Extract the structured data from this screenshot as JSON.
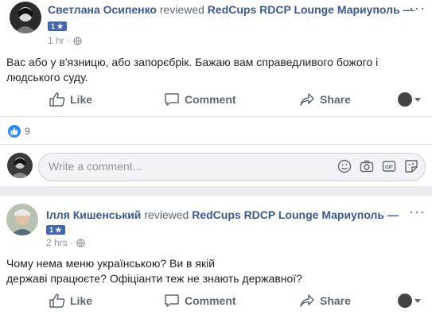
{
  "posts": [
    {
      "author": "Светлана Осипенко",
      "verb": "reviewed",
      "page": "RedCups RDCP Lounge Мариуполь —",
      "rating": "1 ★",
      "time": "1 hr ·",
      "text_lines": [
        "Вас або у в'язницю, або запорєбрік. Бажаю вам справедливого божого і",
        "людського суду."
      ],
      "actions": {
        "like": "Like",
        "comment": "Comment",
        "share": "Share"
      },
      "likes_count": "9",
      "comment_placeholder": "Write a comment..."
    },
    {
      "author": "Ілля Кишенський",
      "verb": "reviewed",
      "page": "RedCups RDCP Lounge Мариуполь —",
      "rating": "1 ★",
      "time": "2 hrs ·",
      "text_lines": [
        "Чому нема меню українською? Ви в якій",
        "державі працюєте? Офіціанти теж не знають державної?"
      ],
      "actions": {
        "like": "Like",
        "comment": "Comment",
        "share": "Share"
      }
    }
  ],
  "more_menu": "···",
  "icons": [
    "more-options-icon",
    "globe-icon",
    "like-icon",
    "comment-icon",
    "share-icon",
    "emoji-icon",
    "camera-icon",
    "gif-icon",
    "sticker-icon",
    "like-reaction-icon"
  ],
  "colors": {
    "link": "#385898",
    "badge": "#4267b2",
    "like_reaction": "#2d88ff",
    "muted": "#606770"
  }
}
